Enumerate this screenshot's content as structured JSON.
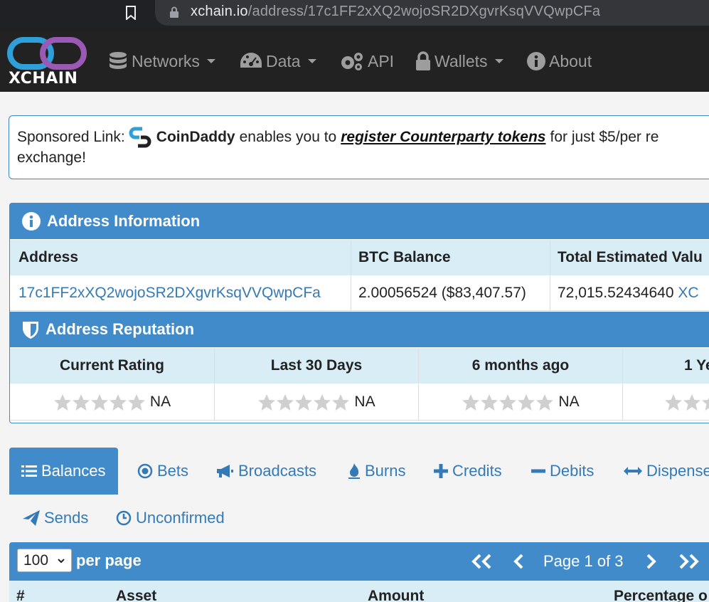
{
  "browser": {
    "url_host": "xchain.io",
    "url_path": "/address/17c1FF2xXQ2wojoSR2DXgvrKsqVVQwpCFa"
  },
  "nav": {
    "logo_text": "XCHAIN",
    "items": [
      {
        "label": "Networks"
      },
      {
        "label": "Data"
      },
      {
        "label": "API"
      },
      {
        "label": "Wallets"
      },
      {
        "label": "About"
      }
    ]
  },
  "sponsored": {
    "prefix": "Sponsored Link:",
    "brand": "CoinDaddy",
    "text1": "enables you to",
    "link": "register Counterparty tokens",
    "text2": "for just $5/per re",
    "line2": "exchange!"
  },
  "address_info": {
    "heading": "Address Information",
    "columns": [
      "Address",
      "BTC Balance",
      "Total Estimated Valu"
    ],
    "address": "17c1FF2xXQ2wojoSR2DXgvrKsqVVQwpCFa",
    "btc_balance": "2.00056524 ($83,407.57)",
    "total_value": "72,015.52434640",
    "total_unit": "XC"
  },
  "reputation": {
    "heading": "Address Reputation",
    "columns": [
      "Current Rating",
      "Last 30 Days",
      "6 months ago",
      "1 Ye"
    ],
    "values": [
      "NA",
      "NA",
      "NA",
      ""
    ]
  },
  "tabs": [
    {
      "label": "Balances"
    },
    {
      "label": "Bets"
    },
    {
      "label": "Broadcasts"
    },
    {
      "label": "Burns"
    },
    {
      "label": "Credits"
    },
    {
      "label": "Debits"
    },
    {
      "label": "Dispense"
    },
    {
      "label": "Sends"
    },
    {
      "label": "Unconfirmed"
    }
  ],
  "table": {
    "per_page_value": "100",
    "per_page_label": "per page",
    "page_label": "Page 1 of 3",
    "columns": [
      "#",
      "Asset",
      "Amount",
      "Percentage o"
    ]
  },
  "colors": {
    "primary": "#428bca",
    "header_bg": "#d9edf7",
    "navbar": "#222222",
    "link": "#337ab7"
  }
}
